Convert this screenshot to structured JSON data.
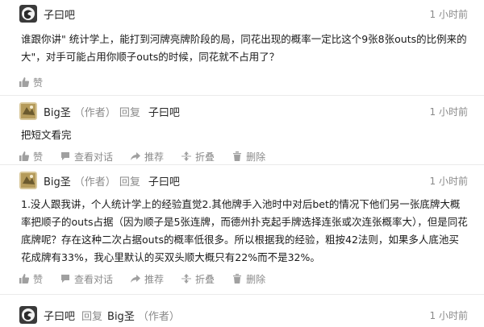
{
  "comments": [
    {
      "author": "子曰吧",
      "author_tag": "",
      "reply_word": "",
      "reply_to": "",
      "reply_to_tag": "",
      "time": "1 小时前",
      "text": "谁跟你讲\" 统计学上，能打到河牌亮牌阶段的局，同花出现的概率一定比这个9张8张outs的比例来的大\"，对手可能占用你顺子outs的时候，同花就不占用了？",
      "actions": {
        "like": "赞"
      }
    },
    {
      "author": "Big圣",
      "author_tag": "（作者）",
      "reply_word": "回复",
      "reply_to": "子曰吧",
      "reply_to_tag": "",
      "time": "1 小时前",
      "text": "把短文看完",
      "actions": {
        "like": "赞",
        "view": "查看对话",
        "recommend": "推荐",
        "fold": "折叠",
        "delete": "删除"
      }
    },
    {
      "author": "Big圣",
      "author_tag": "（作者）",
      "reply_word": "回复",
      "reply_to": "子曰吧",
      "reply_to_tag": "",
      "time": "1 小时前",
      "text": "1.没人跟我讲，个人统计学上的经验直觉2.其他牌手入池时中对后bet的情况下他们另一张底牌大概率把顺子的outs占据（因为顺子是5张连牌，而德州扑克起手牌选择连张或次连张概率大），但是同花底牌呢？存在这种二次占据outs的概率低很多。所以根据我的经验，粗按42法则，如果多人底池买花成牌有33%，我心里默认的买双头顺大概只有22%而不是32%。",
      "actions": {
        "like": "赞",
        "view": "查看对话",
        "recommend": "推荐",
        "fold": "折叠",
        "delete": "删除"
      }
    },
    {
      "author": "子曰吧",
      "author_tag": "",
      "reply_word": "回复",
      "reply_to": "Big圣",
      "reply_to_tag": "（作者）",
      "time": "1 小时前",
      "text": "",
      "actions": {}
    }
  ]
}
